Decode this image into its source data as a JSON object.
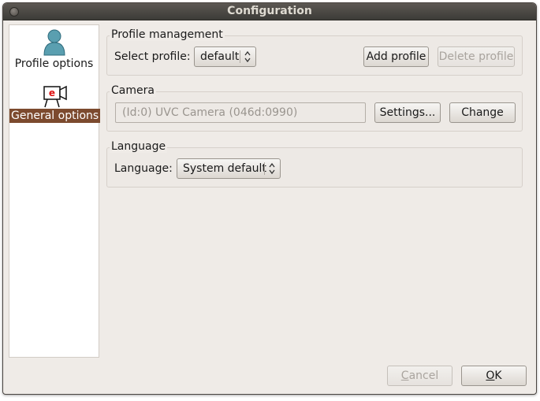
{
  "window": {
    "title": "Configuration"
  },
  "sidebar": {
    "items": [
      {
        "label": "Profile options",
        "icon": "user-icon",
        "selected": false
      },
      {
        "label": "General options",
        "icon": "camera-icon",
        "selected": true
      }
    ]
  },
  "profile_management": {
    "title": "Profile management",
    "select_label": "Select profile:",
    "selected_profile": "default",
    "add_button": "Add profile",
    "delete_button": "Delete profile"
  },
  "camera": {
    "title": "Camera",
    "device_value": "(Id:0) UVC Camera (046d:0990)",
    "settings_button": "Settings...",
    "change_button": "Change"
  },
  "language": {
    "title": "Language",
    "label": "Language:",
    "selected": "System default"
  },
  "footer": {
    "cancel_first": "C",
    "cancel_rest": "ancel",
    "ok_first": "O",
    "ok_rest": "K"
  },
  "colors": {
    "selection": "#7c4a2e",
    "window_bg": "#efebe7",
    "titlebar": "#3c3b37"
  }
}
